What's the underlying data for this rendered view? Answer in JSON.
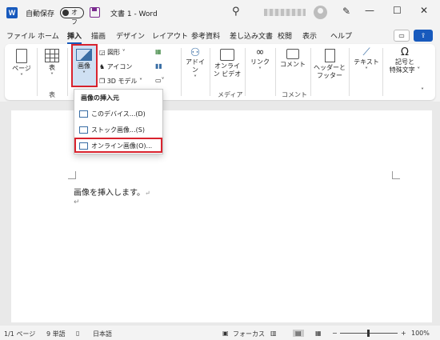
{
  "titlebar": {
    "app_icon": "W",
    "autosave_label": "自動保存",
    "autosave_state": "オフ",
    "doc_title": "文書 1 - Word",
    "minimize": "—",
    "restore": "☐",
    "close": "✕"
  },
  "tabs": [
    "ファイル",
    "ホーム",
    "挿入",
    "描画",
    "デザイン",
    "レイアウト",
    "参考資料",
    "差し込み文書",
    "校閲",
    "表示",
    "ヘルプ"
  ],
  "active_tab": "挿入",
  "ribbon": {
    "page_label": "ページ",
    "table_label": "表",
    "image_label": "画像",
    "shapes_label": "図形",
    "icons_label": "アイコン",
    "model3d_label": "3D モデル",
    "addins_label": "アドイン",
    "online_video_l1": "オンライ",
    "online_video_l2": "ン ビデオ",
    "link_label": "リンク",
    "comment_label": "コメント",
    "headerfooter_l1": "ヘッダーと",
    "headerfooter_l2": "フッター",
    "text_label": "テキスト",
    "symbol_l1": "記号と",
    "symbol_l2": "特殊文字",
    "group_table": "表",
    "group_media": "メディア",
    "group_comment": "コメント"
  },
  "dropdown": {
    "header": "画像の挿入元",
    "items": [
      "このデバイス...(D)",
      "ストック画像...(S)",
      "オンライン画像(O)..."
    ]
  },
  "document": {
    "line1": "画像を挿入します。",
    "para_mark": "↵"
  },
  "status": {
    "page": "1/1 ページ",
    "words": "9 単語",
    "language": "日本語",
    "focus": "フォーカス",
    "zoom": "100%",
    "zoom_minus": "−",
    "zoom_plus": "+"
  },
  "colors": {
    "accent": "#185abd",
    "highlight_red": "#d9232e"
  }
}
